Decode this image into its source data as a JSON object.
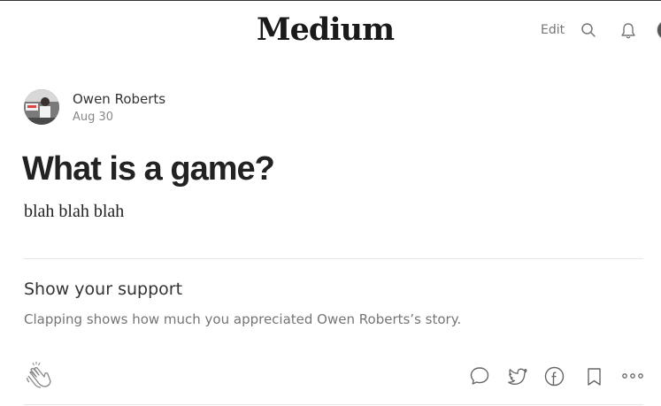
{
  "header": {
    "logo": "Medium",
    "edit_label": "Edit",
    "icons": [
      "search-icon",
      "bell-icon",
      "avatar"
    ]
  },
  "post": {
    "author_name": "Owen Roberts",
    "date": "Aug 30",
    "title": "What is a game?",
    "body": "blah blah blah"
  },
  "support": {
    "heading": "Show your support",
    "text": "Clapping shows how much you appreciated Owen Roberts’s story."
  },
  "actions": {
    "icons": [
      "clap-icon",
      "comment-icon",
      "twitter-icon",
      "facebook-icon",
      "bookmark-icon",
      "more-icon"
    ]
  },
  "colors": {
    "text_dark": "#222222",
    "text_muted": "#757575",
    "icon_gray": "#666666",
    "divider": "#e6e6e6"
  }
}
